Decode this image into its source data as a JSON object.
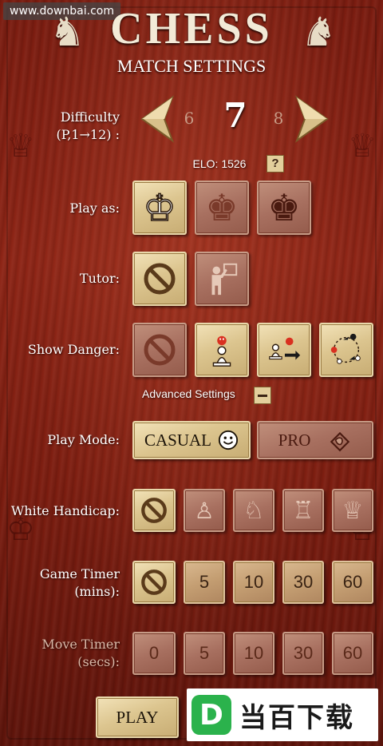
{
  "watermark": "www.downbai.com",
  "header": {
    "title": "CHESS",
    "subtitle": "MATCH SETTINGS"
  },
  "difficulty": {
    "label_line1": "Difficulty",
    "label_line2": "(P,1→12) :",
    "prev": "6",
    "current": "7",
    "next": "8",
    "elo": "ELO: 1526",
    "help": "?"
  },
  "play_as": {
    "label": "Play as:",
    "options": [
      "white-king-icon",
      "random-king-icon",
      "black-king-icon"
    ],
    "selected": 0
  },
  "tutor": {
    "label": "Tutor:",
    "options": [
      "off-icon",
      "tutor-icon"
    ],
    "selected": 0
  },
  "show_danger": {
    "label": "Show Danger:",
    "options": [
      "off-icon",
      "danger-piece-icon",
      "danger-move-icon",
      "danger-all-icon"
    ],
    "selected": 1
  },
  "advanced": {
    "label": "Advanced Settings",
    "toggle": "−"
  },
  "play_mode": {
    "label": "Play Mode:",
    "casual": "CASUAL",
    "pro": "PRO",
    "selected": "CASUAL"
  },
  "white_handicap": {
    "label": "White Handicap:",
    "options": [
      "off-icon",
      "pawn-icon",
      "knight-icon",
      "rook-icon",
      "queen-icon"
    ],
    "selected": 0
  },
  "game_timer": {
    "label_line1": "Game Timer",
    "label_line2": "(mins):",
    "options": [
      "off",
      "5",
      "10",
      "30",
      "60"
    ],
    "selected": 0
  },
  "move_timer": {
    "label_line1": "Move Timer",
    "label_line2": "(secs):",
    "options": [
      "0",
      "5",
      "10",
      "30",
      "60"
    ]
  },
  "play_button": "PLAY",
  "brand": {
    "logo": "D",
    "text": "当百下载"
  },
  "colors": {
    "wood_dark": "#6a170c",
    "tile_light": "#dcc58f",
    "tile_off": "#a87060",
    "brand_green": "#2bb24c"
  }
}
